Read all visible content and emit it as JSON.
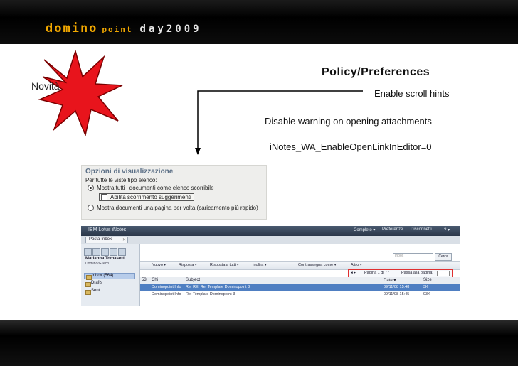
{
  "header": {
    "brand_part1": "domino",
    "brand_part2": "point",
    "brand_part3": "day2009"
  },
  "badge": {
    "label": "Novità",
    "color": "#e8141c"
  },
  "policy": {
    "title": "Policy/Preferences",
    "items": [
      "Enable scroll hints",
      "Disable warning on opening attachments",
      "iNotes_WA_EnableOpenLinkInEditor=0"
    ]
  },
  "options_panel": {
    "title": "Opzioni di visualizzazione",
    "subtitle": "Per tutte le viste tipo elenco:",
    "option1": "Mostra tutti i documenti come elenco scorribile",
    "checkbox": "Abilita scorrimento suggerimenti",
    "option2": "Mostra documenti una pagina per volta (caricamento più rapido)"
  },
  "inotes": {
    "app_title": "IBM Lotus iNotes",
    "top_menu": [
      "Completo ▾",
      "Preferenze",
      "Disconnetti",
      "? ▾"
    ],
    "tab": "Posta-Inbox",
    "user_name": "Marianna Tomasetti",
    "user_sub": "Domino/GTech",
    "folders": [
      "Inbox (564)",
      "Drafts",
      "Sent"
    ],
    "search_placeholder": "Inbox",
    "search_button": "Cerca",
    "toolbar": [
      "Nuovo ▾",
      "Risposta ▾",
      "Risposta a tutti ▾",
      "Inoltra ▾",
      "Contrassegna come ▾",
      "Altro ▾"
    ],
    "pager": {
      "page_text": "Pagina 1 di 77",
      "goto_label": "Passa alla pagina:"
    },
    "columns": [
      "Chi",
      "Subject",
      "Date ▾",
      "Size"
    ],
    "count": "53",
    "rows": [
      {
        "who": "Dominopoint Info",
        "subject": "Re: RE: Re: Template Dominopoint 3",
        "date": "09/11/08 15:48",
        "size": "3K"
      },
      {
        "who": "Dominopoint Info",
        "subject": "Re: Template Dominopoint 3",
        "date": "09/11/08 15:45",
        "size": "93K"
      }
    ]
  }
}
